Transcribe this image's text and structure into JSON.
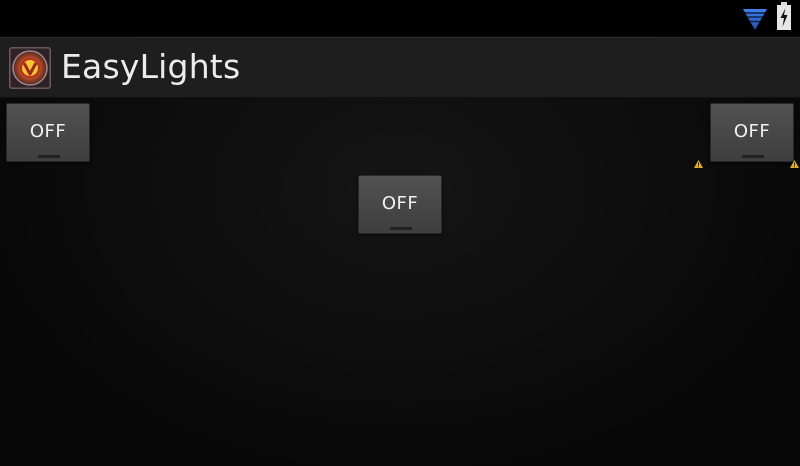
{
  "status_bar": {
    "icons": [
      "wifi-icon",
      "battery-charging-icon"
    ],
    "wifi_color": "#2f6fd8"
  },
  "action_bar": {
    "app_icon": "easylights-logo-icon",
    "title": "EasyLights"
  },
  "lights": [
    {
      "label": "OFF",
      "state": "off"
    },
    {
      "label": "OFF",
      "state": "off"
    },
    {
      "label": "OFF",
      "state": "off"
    }
  ],
  "warnings": [
    "warning-icon",
    "warning-icon"
  ],
  "colors": {
    "background": "#0c0c0c",
    "action_bar": "#1e1e1e",
    "button": "#4a4a4a",
    "warning": "#e0b020"
  }
}
